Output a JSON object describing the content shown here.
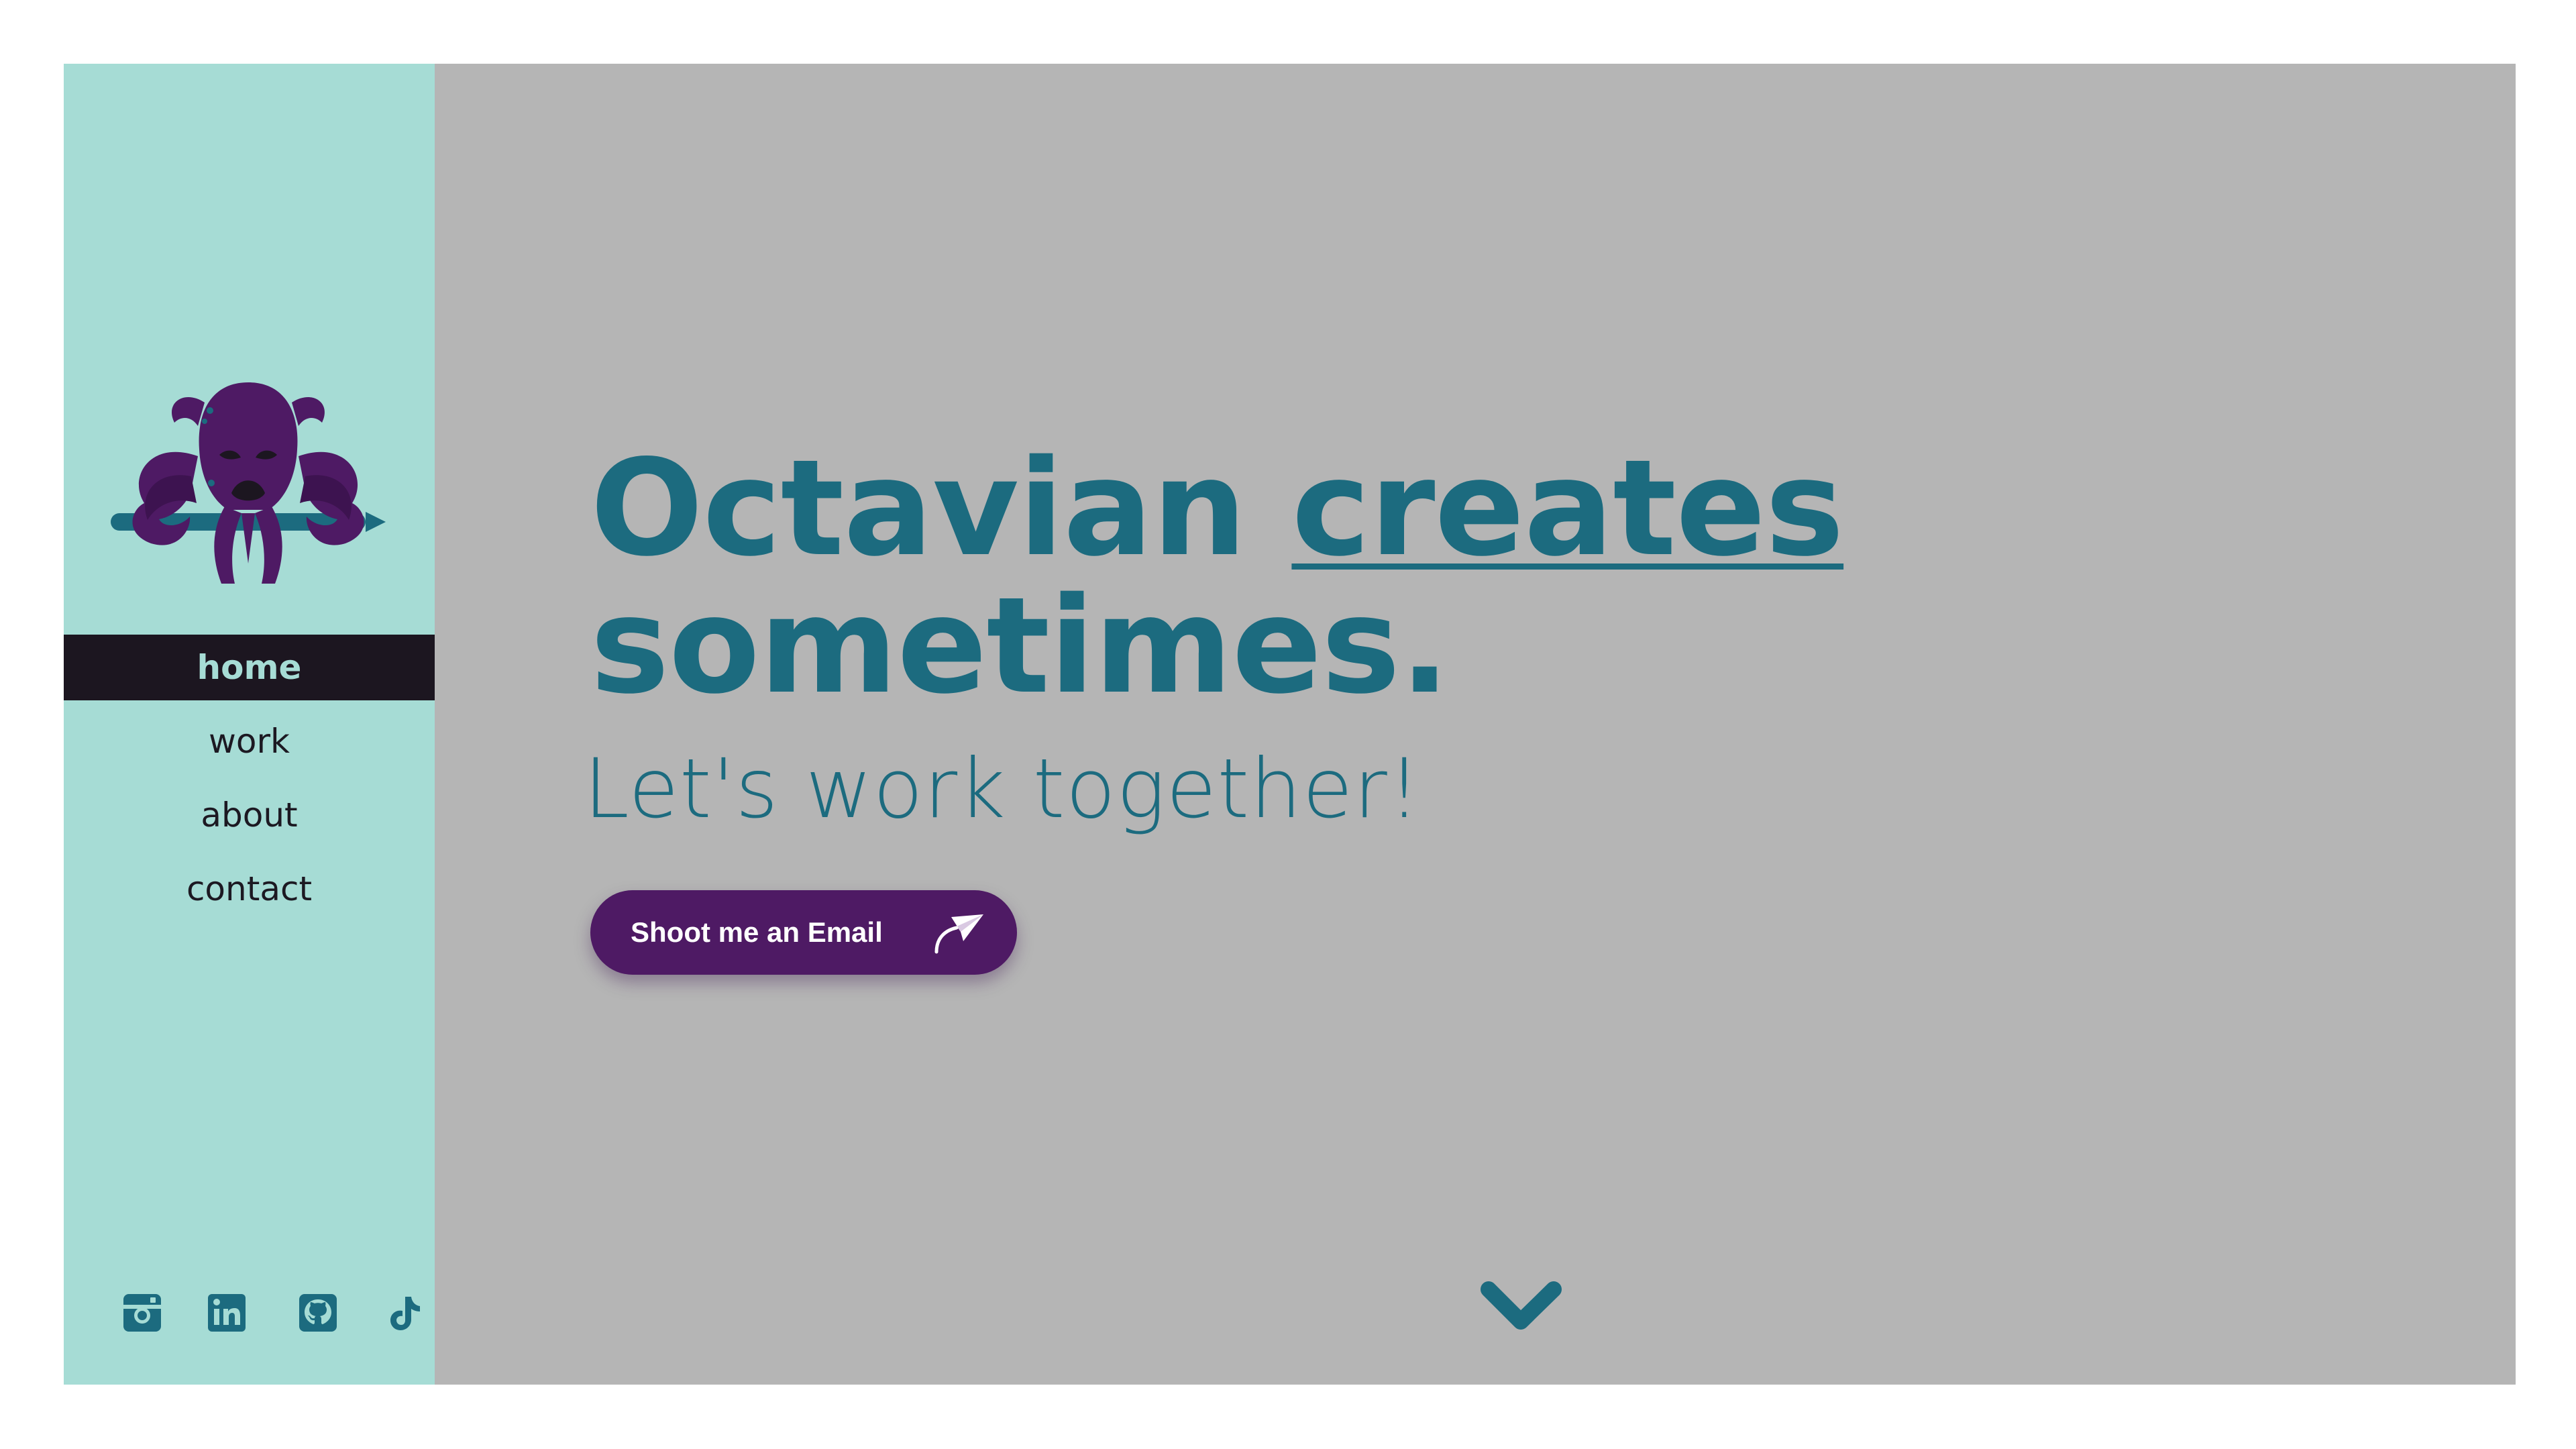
{
  "colors": {
    "page_background": "#ffffff",
    "content_background": "#b5b5b5",
    "sidebar_background": "#a6dcd5",
    "nav_active_background": "#1c1620",
    "accent_teal": "#1c6b7f",
    "button_purple": "#4e1a64",
    "logo_purple": "#4e1a64"
  },
  "sidebar": {
    "logo_icon": "octopus-logo-icon",
    "nav": [
      {
        "label": "home",
        "active": true
      },
      {
        "label": "work",
        "active": false
      },
      {
        "label": "about",
        "active": false
      },
      {
        "label": "contact",
        "active": false
      }
    ],
    "socials": [
      {
        "icon": "instagram-icon"
      },
      {
        "icon": "linkedin-icon"
      },
      {
        "icon": "github-icon"
      },
      {
        "icon": "tiktok-icon"
      }
    ]
  },
  "hero": {
    "headline_part1": "Octavian ",
    "headline_emphasis": "creates",
    "headline_part2": "sometimes.",
    "subline": "Let's work together!",
    "cta_label": "Shoot me an Email",
    "cta_icon": "paper-plane-icon",
    "scroll_icon": "chevron-down-icon"
  }
}
